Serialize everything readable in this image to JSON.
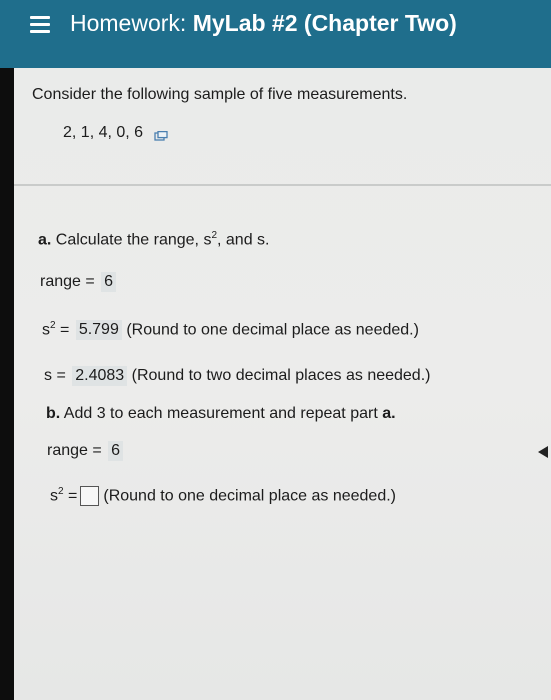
{
  "header": {
    "menu_icon": "hamburger-menu-icon",
    "title_prefix": "Homework: ",
    "title_main": "MyLab #2 (Chapter Two)",
    "color": "#1f6e8c"
  },
  "question": {
    "prompt": "Consider the following sample of five measurements.",
    "sample": "2, 1, 4, 0, 6",
    "copy_icon": "copy-data-icon"
  },
  "part_a": {
    "label": "a.",
    "text_before": " Calculate the range, s",
    "sup": "2",
    "text_after": ", and s.",
    "range_label": "range =",
    "range_value": "6",
    "s2_label": "s",
    "s2_sup": "2",
    "s2_eq": "=",
    "s2_value": "5.799",
    "s2_hint": "(Round to one decimal place as needed.)",
    "s_label": "s =",
    "s_value": "2.4083",
    "s_hint": "(Round to two decimal places as needed.)"
  },
  "part_b": {
    "label": "b.",
    "text_before": " Add 3 to each measurement and repeat part ",
    "text_bold_end": "a.",
    "range_label": "range =",
    "range_value": "6",
    "s2_label": "s",
    "s2_sup": "2",
    "s2_eq": "=",
    "s2_value": "",
    "s2_hint": "(Round to one decimal place as needed.)"
  }
}
